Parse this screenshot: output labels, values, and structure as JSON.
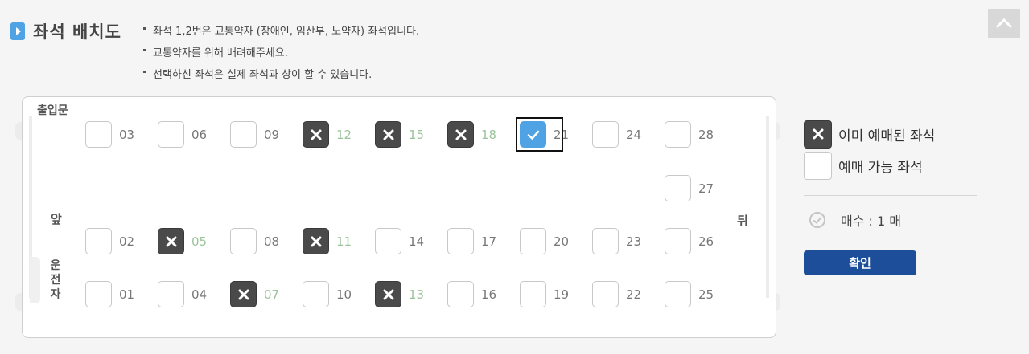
{
  "title": "좌석 배치도",
  "notices": [
    "좌석 1,2번은 교통약자 (장애인, 임산부, 노약자) 좌석입니다.",
    "교통약자를 위해 배려해주세요.",
    "선택하신 좌석은 실제 좌석과 상이 할 수 있습니다."
  ],
  "bus": {
    "door_label": "출입문",
    "front_label": "앞",
    "back_label": "뒤",
    "driver_label": [
      "운",
      "전",
      "자"
    ]
  },
  "seats": {
    "s03": {
      "num": "03",
      "state": "available"
    },
    "s06": {
      "num": "06",
      "state": "available"
    },
    "s09": {
      "num": "09",
      "state": "available"
    },
    "s12": {
      "num": "12",
      "state": "sold"
    },
    "s15": {
      "num": "15",
      "state": "sold"
    },
    "s18": {
      "num": "18",
      "state": "sold"
    },
    "s21": {
      "num": "21",
      "state": "selected"
    },
    "s24": {
      "num": "24",
      "state": "available"
    },
    "s28": {
      "num": "28",
      "state": "available"
    },
    "s27": {
      "num": "27",
      "state": "available"
    },
    "s02": {
      "num": "02",
      "state": "available"
    },
    "s05": {
      "num": "05",
      "state": "sold"
    },
    "s08": {
      "num": "08",
      "state": "available"
    },
    "s11": {
      "num": "11",
      "state": "sold"
    },
    "s14": {
      "num": "14",
      "state": "available"
    },
    "s17": {
      "num": "17",
      "state": "available"
    },
    "s20": {
      "num": "20",
      "state": "available"
    },
    "s23": {
      "num": "23",
      "state": "available"
    },
    "s26": {
      "num": "26",
      "state": "available"
    },
    "s01": {
      "num": "01",
      "state": "available"
    },
    "s04": {
      "num": "04",
      "state": "available"
    },
    "s07": {
      "num": "07",
      "state": "sold"
    },
    "s10": {
      "num": "10",
      "state": "available"
    },
    "s13": {
      "num": "13",
      "state": "sold"
    },
    "s16": {
      "num": "16",
      "state": "available"
    },
    "s19": {
      "num": "19",
      "state": "available"
    },
    "s22": {
      "num": "22",
      "state": "available"
    },
    "s25": {
      "num": "25",
      "state": "available"
    }
  },
  "legend": {
    "sold_label": "이미 예매된 좌석",
    "available_label": "예매 가능 좌석"
  },
  "count_label": "매수 : 1 매",
  "confirm_label": "확인",
  "colors": {
    "accent": "#4fa3e4",
    "sold": "#4a4a4a",
    "confirm": "#1d4e9a",
    "sold_number": "#9cc49c"
  }
}
